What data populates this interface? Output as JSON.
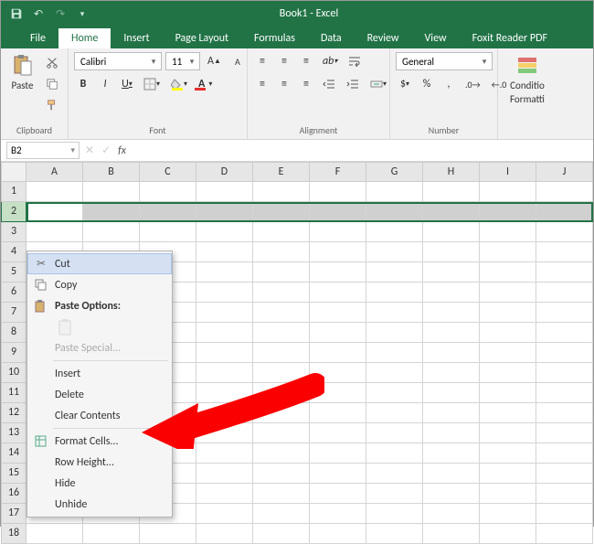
{
  "title": "Book1 - Excel",
  "tabs": [
    "File",
    "Home",
    "Insert",
    "Page Layout",
    "Formulas",
    "Data",
    "Review",
    "View",
    "Foxit Reader PDF"
  ],
  "activeTab": "Home",
  "ribbon": {
    "clipboard": {
      "paste": "Paste",
      "label": "Clipboard"
    },
    "font": {
      "name": "Calibri",
      "size": "11",
      "label": "Font",
      "bold": "B",
      "italic": "I",
      "underline": "U"
    },
    "alignment": {
      "label": "Alignment"
    },
    "number": {
      "format": "General",
      "label": "Number"
    },
    "conditional": {
      "l1": "Conditio",
      "l2": "Formatti"
    }
  },
  "namebox": "B2",
  "columns": [
    "A",
    "B",
    "C",
    "D",
    "E",
    "F",
    "G",
    "H",
    "I",
    "J"
  ],
  "rowCount": 18,
  "selectedRow": 2,
  "context": {
    "cut": "Cut",
    "copy": "Copy",
    "pasteOptions": "Paste Options:",
    "pasteSpecial": "Paste Special...",
    "insert": "Insert",
    "delete": "Delete",
    "clear": "Clear Contents",
    "formatCells": "Format Cells...",
    "rowHeight": "Row Height...",
    "hide": "Hide",
    "unhide": "Unhide"
  }
}
